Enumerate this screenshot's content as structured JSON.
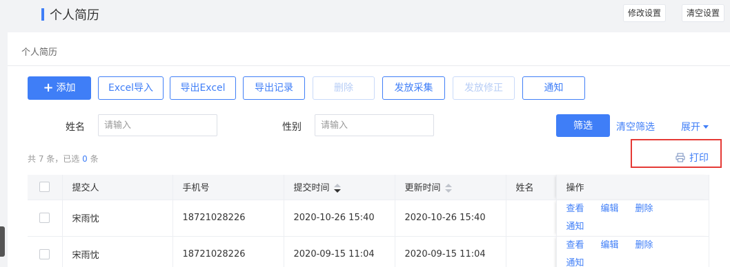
{
  "header": {
    "title": "个人简历",
    "settings_label": "修改设置",
    "clear_settings_label": "清空设置"
  },
  "breadcrumb": "个人简历",
  "toolbar": {
    "add": "添加",
    "import_excel": "Excel导入",
    "export_excel": "导出Excel",
    "export_records": "导出记录",
    "delete": "删除",
    "send_collect": "发放采集",
    "send_fix": "发放修正",
    "notify": "通知"
  },
  "filters": {
    "name_label": "姓名",
    "name_placeholder": "请输入",
    "gender_label": "性别",
    "gender_placeholder": "请输入",
    "filter": "筛选",
    "clear": "清空筛选",
    "expand": "展开"
  },
  "summary": {
    "prefix": "共 7 条，已选",
    "selected": "0",
    "suffix": "条"
  },
  "print_label": "打印",
  "table": {
    "columns": [
      "提交人",
      "手机号",
      "提交时间",
      "更新时间",
      "姓名",
      "操作"
    ],
    "rows": [
      {
        "submitter": "宋雨忱",
        "phone": "18721028226",
        "submitted": "2020-10-26 15:40",
        "updated": "2020-10-26 15:40",
        "name": ""
      },
      {
        "submitter": "宋雨忱",
        "phone": "18721028226",
        "submitted": "2020-09-15 11:04",
        "updated": "2020-09-15 11:04",
        "name": ""
      }
    ],
    "actions": {
      "view": "查看",
      "edit": "编辑",
      "delete": "删除",
      "notify": "通知"
    }
  },
  "colors": {
    "accent": "#3f7ef7",
    "highlight_border": "#e53935"
  },
  "icons": {
    "add": "plus-icon",
    "print": "printer-icon",
    "expand": "caret-down-icon",
    "sort": "sort-icon"
  }
}
